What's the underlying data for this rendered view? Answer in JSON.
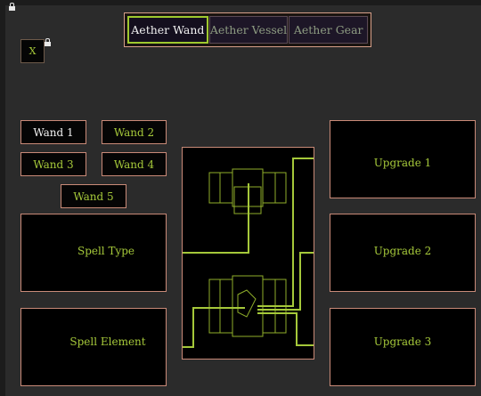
{
  "tabs": [
    {
      "label": "Aether Wand",
      "active": true
    },
    {
      "label": "Aether Vessel",
      "active": false
    },
    {
      "label": "Aether Gear",
      "active": false
    }
  ],
  "close_button": {
    "label": "X"
  },
  "wands": [
    "Wand 1",
    "Wand 2",
    "Wand 3",
    "Wand 4",
    "Wand 5"
  ],
  "selected_wand": "Wand 1",
  "slots": {
    "spell_type": "Spell Type",
    "spell_element": "Spell Element",
    "upgrade_1": "Upgrade 1",
    "upgrade_2": "Upgrade 2",
    "upgrade_3": "Upgrade 3"
  },
  "colors": {
    "accent": "#a5c83a",
    "border": "#c98a78",
    "background": "#2b2b2b",
    "panel": "#000000"
  },
  "icons": {
    "lock": "lock-icon"
  }
}
